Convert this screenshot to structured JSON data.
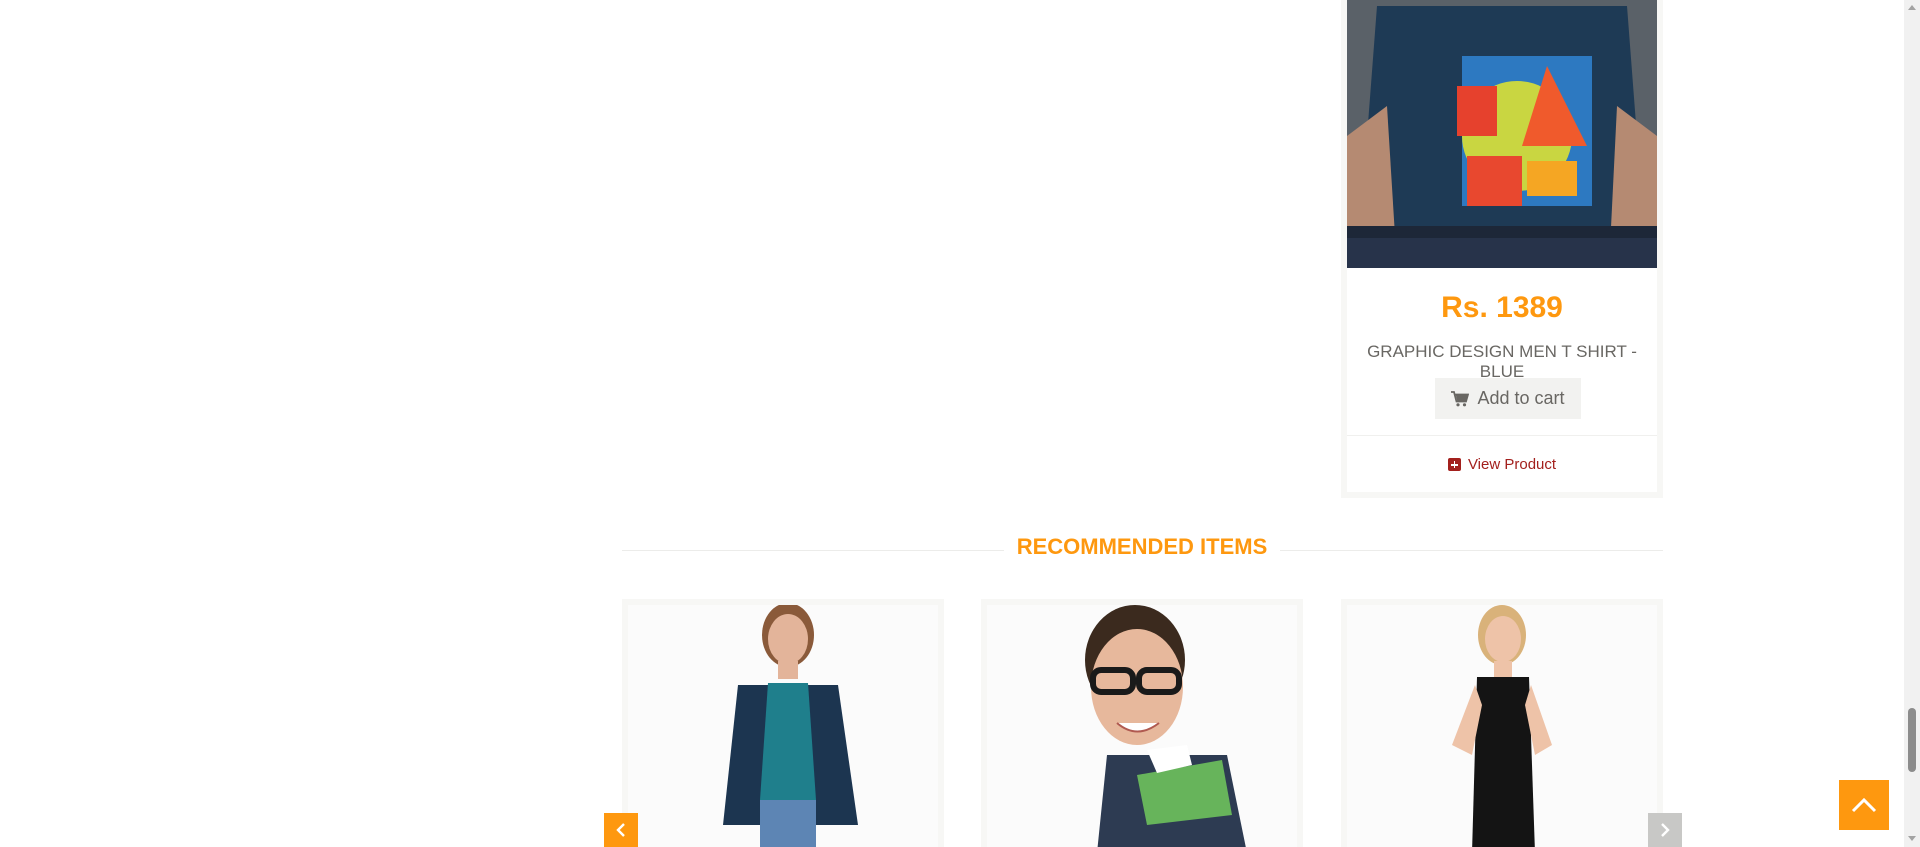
{
  "featured_product": {
    "price": "Rs. 1389",
    "name": "GRAPHIC DESIGN MEN T SHIRT - BLUE",
    "add_to_cart_label": "Add to cart",
    "view_product_label": "View Product",
    "cart_icon": "shopping-cart-icon",
    "view_icon": "plus-square-icon"
  },
  "recommended": {
    "title": "RECOMMENDED ITEMS",
    "prev_icon": "chevron-left-icon",
    "next_icon": "chevron-right-icon"
  },
  "scroll_top_icon": "chevron-up-icon",
  "colors": {
    "accent": "#fe980f",
    "text": "#696763",
    "link": "#a3201d",
    "button_bg": "#f2f2f0"
  }
}
